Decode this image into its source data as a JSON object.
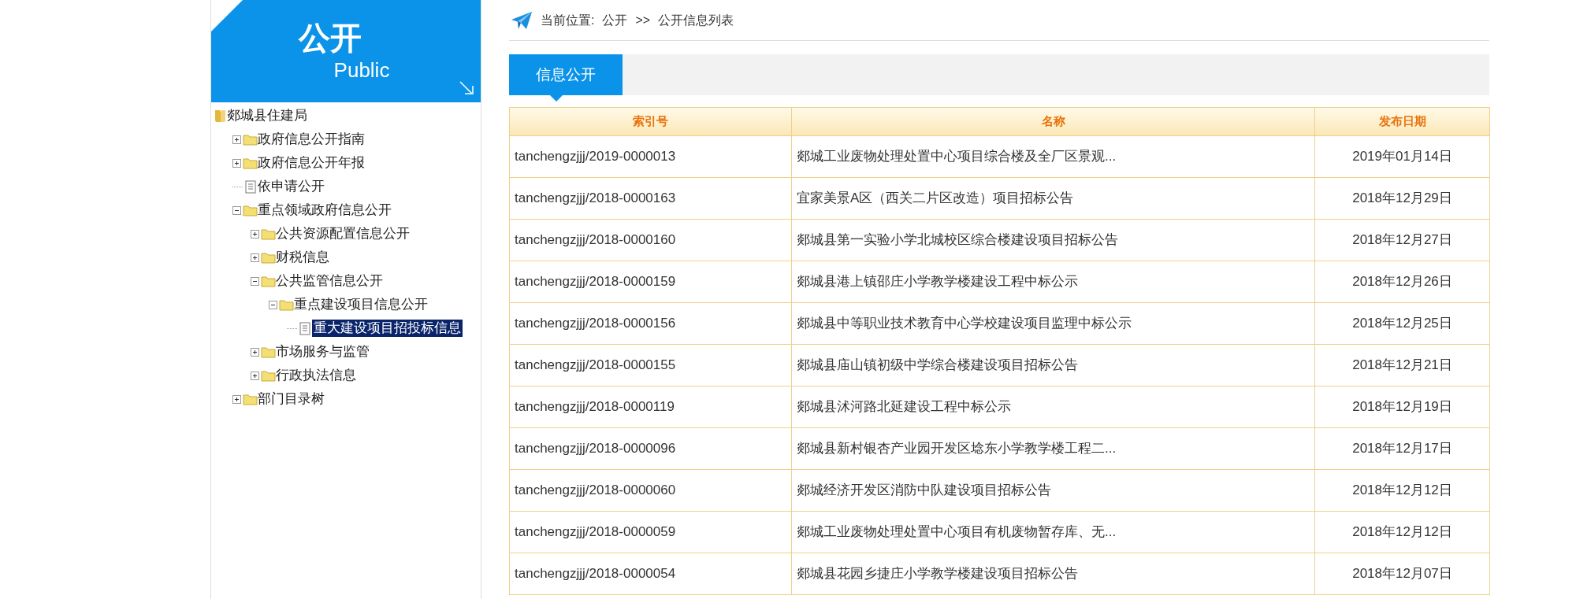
{
  "sidebar": {
    "title": "公开",
    "subtitle": "Public",
    "tree": [
      {
        "label": "郯城县住建局",
        "kind": "root",
        "selected": false,
        "children": [
          {
            "label": "政府信息公开指南",
            "kind": "folder",
            "selected": false,
            "expanded": false
          },
          {
            "label": "政府信息公开年报",
            "kind": "folder",
            "selected": false,
            "expanded": false
          },
          {
            "label": "依申请公开",
            "kind": "page",
            "selected": false
          },
          {
            "label": "重点领域政府信息公开",
            "kind": "folder",
            "selected": false,
            "expanded": true,
            "children": [
              {
                "label": "公共资源配置信息公开",
                "kind": "folder",
                "selected": false,
                "expanded": false
              },
              {
                "label": "财税信息",
                "kind": "folder",
                "selected": false,
                "expanded": false
              },
              {
                "label": "公共监管信息公开",
                "kind": "folder",
                "selected": false,
                "expanded": true,
                "children": [
                  {
                    "label": "重点建设项目信息公开",
                    "kind": "folder",
                    "selected": false,
                    "expanded": true,
                    "children": [
                      {
                        "label": "重大建设项目招投标信息",
                        "kind": "page",
                        "selected": true
                      }
                    ]
                  }
                ]
              },
              {
                "label": "市场服务与监管",
                "kind": "folder",
                "selected": false,
                "expanded": false
              },
              {
                "label": "行政执法信息",
                "kind": "folder",
                "selected": false,
                "expanded": false
              }
            ]
          },
          {
            "label": "部门目录树",
            "kind": "folder",
            "selected": false,
            "expanded": false
          }
        ]
      }
    ]
  },
  "breadcrumb": {
    "label": "当前位置:",
    "items": [
      "公开",
      "公开信息列表"
    ],
    "separator": ">>"
  },
  "tabs": [
    {
      "label": "信息公开",
      "selected": true
    }
  ],
  "table": {
    "columns": [
      "索引号",
      "名称",
      "发布日期"
    ],
    "rows": [
      [
        "tanchengzjjj/2019-0000013",
        "郯城工业废物处理处置中心项目综合楼及全厂区景观...",
        "2019年01月14日"
      ],
      [
        "tanchengzjjj/2018-0000163",
        "宜家美景A区（西关二片区改造）项目招标公告",
        "2018年12月29日"
      ],
      [
        "tanchengzjjj/2018-0000160",
        "郯城县第一实验小学北城校区综合楼建设项目招标公告",
        "2018年12月27日"
      ],
      [
        "tanchengzjjj/2018-0000159",
        "郯城县港上镇邵庄小学教学楼建设工程中标公示",
        "2018年12月26日"
      ],
      [
        "tanchengzjjj/2018-0000156",
        "郯城县中等职业技术教育中心学校建设项目监理中标公示",
        "2018年12月25日"
      ],
      [
        "tanchengzjjj/2018-0000155",
        "郯城县庙山镇初级中学综合楼建设项目招标公告",
        "2018年12月21日"
      ],
      [
        "tanchengzjjj/2018-0000119",
        "郯城县沭河路北延建设工程中标公示",
        "2018年12月19日"
      ],
      [
        "tanchengzjjj/2018-0000096",
        "郯城县新村银杏产业园开发区埝东小学教学楼工程二...",
        "2018年12月17日"
      ],
      [
        "tanchengzjjj/2018-0000060",
        "郯城经济开发区消防中队建设项目招标公告",
        "2018年12月12日"
      ],
      [
        "tanchengzjjj/2018-0000059",
        "郯城工业废物处理处置中心项目有机废物暂存库、无...",
        "2018年12月12日"
      ],
      [
        "tanchengzjjj/2018-0000054",
        "郯城县花园乡捷庄小学教学楼建设项目招标公告",
        "2018年12月07日"
      ]
    ]
  }
}
